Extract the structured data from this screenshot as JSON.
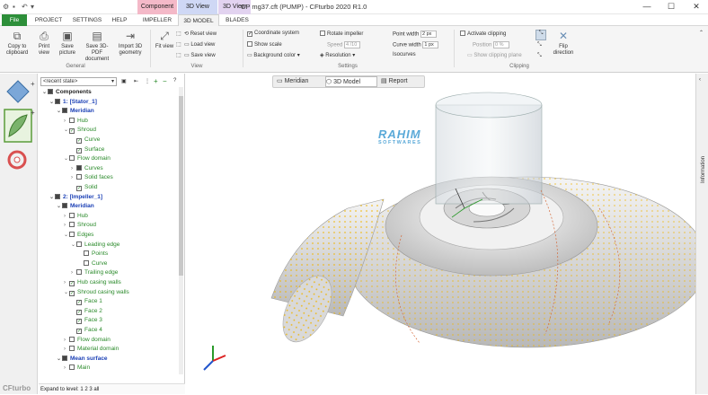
{
  "titlebar": {
    "title": "CP mg37.cft (PUMP) - CFturbo 2020 R1.0",
    "context_tabs": [
      {
        "label": "Component",
        "color": "#f4b9c8"
      },
      {
        "label": "3D View",
        "color": "#cfd8f5"
      },
      {
        "label": "3D View",
        "color": "#e2d3f0"
      }
    ],
    "minimize": "—",
    "maximize": "☐",
    "close": "✕"
  },
  "tabs": [
    "File",
    "PROJECT",
    "SETTINGS",
    "HELP",
    "IMPELLER",
    "3D MODEL",
    "BLADES"
  ],
  "ribbon": {
    "general": {
      "label": "General",
      "buttons": [
        "Copy to clipboard",
        "Print view",
        "Save picture",
        "Save 3D-PDF document",
        "Import 3D geometry"
      ]
    },
    "view": {
      "label": "View",
      "fit": "Fit view",
      "reset": "Reset view",
      "load": "Load view",
      "save": "Save view"
    },
    "settings": {
      "label": "Settings",
      "coordinate_system": "Coordinate system",
      "show_scale": "Show scale",
      "background_color": "Background color",
      "rotate_impeller": "Rotate impeller",
      "speed_label": "Speed",
      "speed_value": "4 /10",
      "resolution": "Resolution",
      "point_width_label": "Point width",
      "point_width_value": "2 px",
      "curve_width_label": "Curve width",
      "curve_width_value": "1 px",
      "isocurves_label": "Isocurves"
    },
    "clipping": {
      "label": "Clipping",
      "activate": "Activate clipping",
      "position_label": "Position",
      "position_value": "0 %",
      "show_plane": "Show clipping plane",
      "flip": "Flip direction"
    }
  },
  "tree": {
    "state_select": "<recent state>",
    "rows": [
      {
        "text": "Components",
        "indent": 0,
        "style": "bold",
        "exp": "⌄",
        "check": "full"
      },
      {
        "text": "1: [Stator_1]",
        "indent": 1,
        "style": "blue",
        "exp": "⌄",
        "check": "full"
      },
      {
        "text": "Meridian",
        "indent": 2,
        "style": "blue",
        "exp": "⌄",
        "check": "full"
      },
      {
        "text": "Hub",
        "indent": 3,
        "style": "green",
        "exp": "›",
        "check": "none"
      },
      {
        "text": "Shroud",
        "indent": 3,
        "style": "green",
        "exp": "⌄",
        "check": "tick"
      },
      {
        "text": "Curve",
        "indent": 4,
        "style": "green",
        "exp": "",
        "check": "tick"
      },
      {
        "text": "Surface",
        "indent": 4,
        "style": "green",
        "exp": "",
        "check": "tick"
      },
      {
        "text": "Flow domain",
        "indent": 3,
        "style": "green",
        "exp": "⌄",
        "check": "none"
      },
      {
        "text": "Curves",
        "indent": 4,
        "style": "green",
        "exp": "›",
        "check": "full"
      },
      {
        "text": "Solid faces",
        "indent": 4,
        "style": "green",
        "exp": "›",
        "check": "none"
      },
      {
        "text": "Solid",
        "indent": 4,
        "style": "green",
        "exp": "",
        "check": "tick"
      },
      {
        "text": "2: [Impeller_1]",
        "indent": 1,
        "style": "blue",
        "exp": "⌄",
        "check": "full"
      },
      {
        "text": "Meridian",
        "indent": 2,
        "style": "blue",
        "exp": "⌄",
        "check": "full"
      },
      {
        "text": "Hub",
        "indent": 3,
        "style": "green",
        "exp": "›",
        "check": "none"
      },
      {
        "text": "Shroud",
        "indent": 3,
        "style": "green",
        "exp": "›",
        "check": "none"
      },
      {
        "text": "Edges",
        "indent": 3,
        "style": "green",
        "exp": "⌄",
        "check": "none"
      },
      {
        "text": "Leading edge",
        "indent": 4,
        "style": "green",
        "exp": "⌄",
        "check": "none"
      },
      {
        "text": "Points",
        "indent": 5,
        "style": "green",
        "exp": "",
        "check": "none"
      },
      {
        "text": "Curve",
        "indent": 5,
        "style": "green",
        "exp": "",
        "check": "none"
      },
      {
        "text": "Trailing edge",
        "indent": 4,
        "style": "green",
        "exp": "›",
        "check": "none"
      },
      {
        "text": "Hub casing walls",
        "indent": 3,
        "style": "green",
        "exp": "›",
        "check": "tick"
      },
      {
        "text": "Shroud casing walls",
        "indent": 3,
        "style": "green",
        "exp": "⌄",
        "check": "tick"
      },
      {
        "text": "Face 1",
        "indent": 4,
        "style": "green",
        "exp": "",
        "check": "tick"
      },
      {
        "text": "Face 2",
        "indent": 4,
        "style": "green",
        "exp": "",
        "check": "tick"
      },
      {
        "text": "Face 3",
        "indent": 4,
        "style": "green",
        "exp": "",
        "check": "tick"
      },
      {
        "text": "Face 4",
        "indent": 4,
        "style": "green",
        "exp": "",
        "check": "tick"
      },
      {
        "text": "Flow domain",
        "indent": 3,
        "style": "green",
        "exp": "›",
        "check": "none"
      },
      {
        "text": "Material domain",
        "indent": 3,
        "style": "green",
        "exp": "›",
        "check": "none"
      },
      {
        "text": "Mean surface",
        "indent": 2,
        "style": "blue",
        "exp": "⌄",
        "check": "full"
      },
      {
        "text": "Main",
        "indent": 3,
        "style": "green",
        "exp": "›",
        "check": "none"
      }
    ],
    "footer": "Expand to level:  1  2  3  all"
  },
  "viewtabs": [
    "Meridian",
    "3D Model",
    "Report"
  ],
  "right_panel": "Information",
  "watermark": {
    "main": "RAHIM",
    "sub": "SOFTWARES"
  },
  "app_logo": "CFturbo",
  "colors": {
    "file_tab": "#2d8f3a",
    "tree_green": "#2a8a2a",
    "tree_blue": "#1a3fb5",
    "mesh_dots": "#f0b400"
  }
}
